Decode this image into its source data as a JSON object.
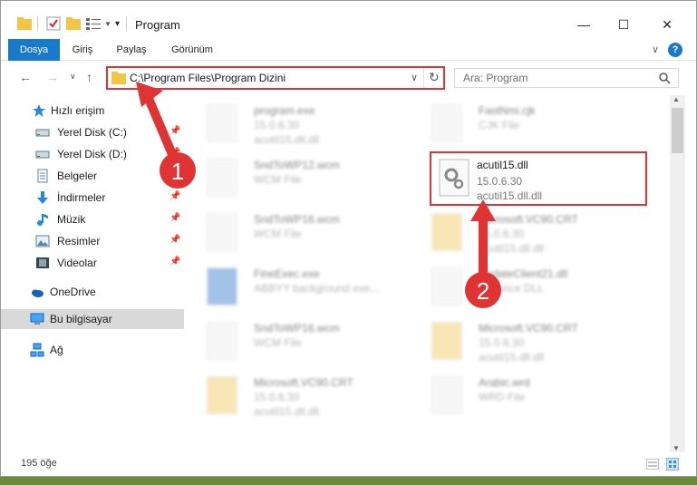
{
  "window": {
    "title": "Program",
    "controls": {
      "minimize": "—",
      "maximize": "☐",
      "close": "✕"
    }
  },
  "ribbon": {
    "tabs": [
      "Dosya",
      "Giriş",
      "Paylaş",
      "Görünüm"
    ],
    "collapse_glyph": "∨",
    "help_glyph": "?"
  },
  "address": {
    "path": "C:\\Program Files\\Program Dizini",
    "dropdown_glyph": "∨",
    "refresh_glyph": "↻"
  },
  "search": {
    "placeholder": "Ara: Program",
    "icon": "search-icon"
  },
  "sidebar": {
    "items": [
      {
        "label": "Hızlı erişim",
        "icon": "star-icon",
        "pinned": false
      },
      {
        "label": "Yerel Disk (C:)",
        "icon": "drive-icon",
        "pinned": true
      },
      {
        "label": "Yerel Disk (D:)",
        "icon": "drive-icon",
        "pinned": true
      },
      {
        "label": "Belgeler",
        "icon": "documents-icon",
        "pinned": true
      },
      {
        "label": "İndirmeler",
        "icon": "download-icon",
        "pinned": true
      },
      {
        "label": "Müzik",
        "icon": "music-icon",
        "pinned": true
      },
      {
        "label": "Resimler",
        "icon": "pictures-icon",
        "pinned": true
      },
      {
        "label": "Videolar",
        "icon": "videos-icon",
        "pinned": true
      },
      {
        "label": "OneDrive",
        "icon": "cloud-icon",
        "pinned": false
      },
      {
        "label": "Bu bilgisayar",
        "icon": "computer-icon",
        "pinned": false,
        "selected": true
      },
      {
        "label": "Ağ",
        "icon": "network-icon",
        "pinned": false
      }
    ]
  },
  "files": [
    {
      "name": "program.exe",
      "l2": "15.0.6.30",
      "l3": "acutil15.dll.dll",
      "blurred": true
    },
    {
      "name": "FastNmi.cjk",
      "l2": "CJK File",
      "l3": "",
      "blurred": true
    },
    {
      "name": "SndToWP12.wcm",
      "l2": "WCM File",
      "l3": "",
      "blurred": true
    },
    {
      "name": "acutil15.dll",
      "l2": "15.0.6.30",
      "l3": "acutil15.dll.dll",
      "blurred": false,
      "highlighted": true
    },
    {
      "name": "SndToWP16.wcm",
      "l2": "WCM File",
      "l3": "",
      "blurred": true
    },
    {
      "name": "Microsoft.VC90.CRT",
      "l2": "15.0.6.30",
      "l3": "acutil15.dll.dll",
      "blurred": true
    },
    {
      "name": "FineExec.exe",
      "l2": "ABBYY background exe...",
      "l3": "",
      "blurred": true
    },
    {
      "name": "UpdateClient21.dll",
      "l2": "Advance DLL",
      "l3": "",
      "blurred": true
    },
    {
      "name": "SndToWP16.wcm",
      "l2": "WCM File",
      "l3": "",
      "blurred": true
    },
    {
      "name": "Microsoft.VC90.CRT",
      "l2": "15.0.6.30",
      "l3": "acutil15.dll.dll",
      "blurred": true
    },
    {
      "name": "Microsoft.VC90.CRT",
      "l2": "15.0.6.30",
      "l3": "acutil15.dll.dll",
      "blurred": true
    },
    {
      "name": "Arabic.wrd",
      "l2": "WRD File",
      "l3": "",
      "blurred": true
    }
  ],
  "status": {
    "count": "195 öğe"
  },
  "annotations": {
    "step1": "1",
    "step2": "2",
    "color": "#e03434"
  },
  "colors": {
    "accent": "#1979ca",
    "highlight": "#e03434"
  }
}
